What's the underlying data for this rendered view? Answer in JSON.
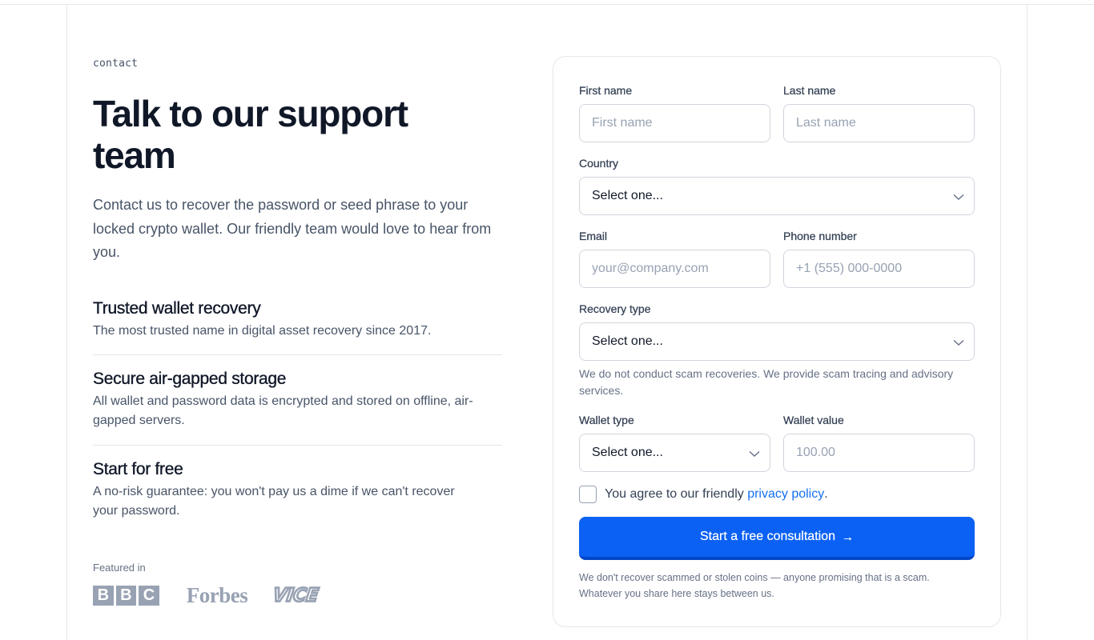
{
  "hero": {
    "eyebrow": "contact",
    "title": "Talk to our support team",
    "lead": "Contact us to recover the password or seed phrase to your locked crypto wallet. Our friendly team would love to hear from you."
  },
  "features": [
    {
      "title": "Trusted wallet recovery",
      "text": "The most trusted name in digital asset recovery since 2017."
    },
    {
      "title": "Secure air-gapped storage",
      "text": "All wallet and password data is encrypted and stored on offline, air-gapped servers."
    },
    {
      "title": "Start for free",
      "text": "A no-risk guarantee: you won't pay us a dime if we can't recover your password."
    }
  ],
  "featured": {
    "label": "Featured in",
    "logos": [
      "B",
      "B",
      "C",
      "Forbes",
      "VICE"
    ]
  },
  "form": {
    "first_name": {
      "label": "First name",
      "placeholder": "First name"
    },
    "last_name": {
      "label": "Last name",
      "placeholder": "Last name"
    },
    "country": {
      "label": "Country",
      "value": "Select one..."
    },
    "email": {
      "label": "Email",
      "placeholder": "your@company.com"
    },
    "phone": {
      "label": "Phone number",
      "placeholder": "+1 (555) 000-0000"
    },
    "recovery_type": {
      "label": "Recovery type",
      "value": "Select one...",
      "hint": "We do not conduct scam recoveries. We provide scam tracing and advisory services."
    },
    "wallet_type": {
      "label": "Wallet type",
      "value": "Select one..."
    },
    "wallet_value": {
      "label": "Wallet value",
      "placeholder": "100.00"
    },
    "agree": {
      "prefix": "You agree to our friendly ",
      "link": "privacy policy",
      "suffix": "."
    },
    "submit": {
      "label": "Start a free consultation",
      "arrow": "→"
    },
    "footnote": "We don't recover scammed or stolen coins — anyone promising that is a scam. Whatever you share here stays between us."
  },
  "colors": {
    "accent": "#0b61f3",
    "link": "#1570ef",
    "text": "#101828",
    "muted": "#475467"
  },
  "icons": {
    "select": "chevron-down-icon",
    "submit": "arrow-right-icon"
  }
}
